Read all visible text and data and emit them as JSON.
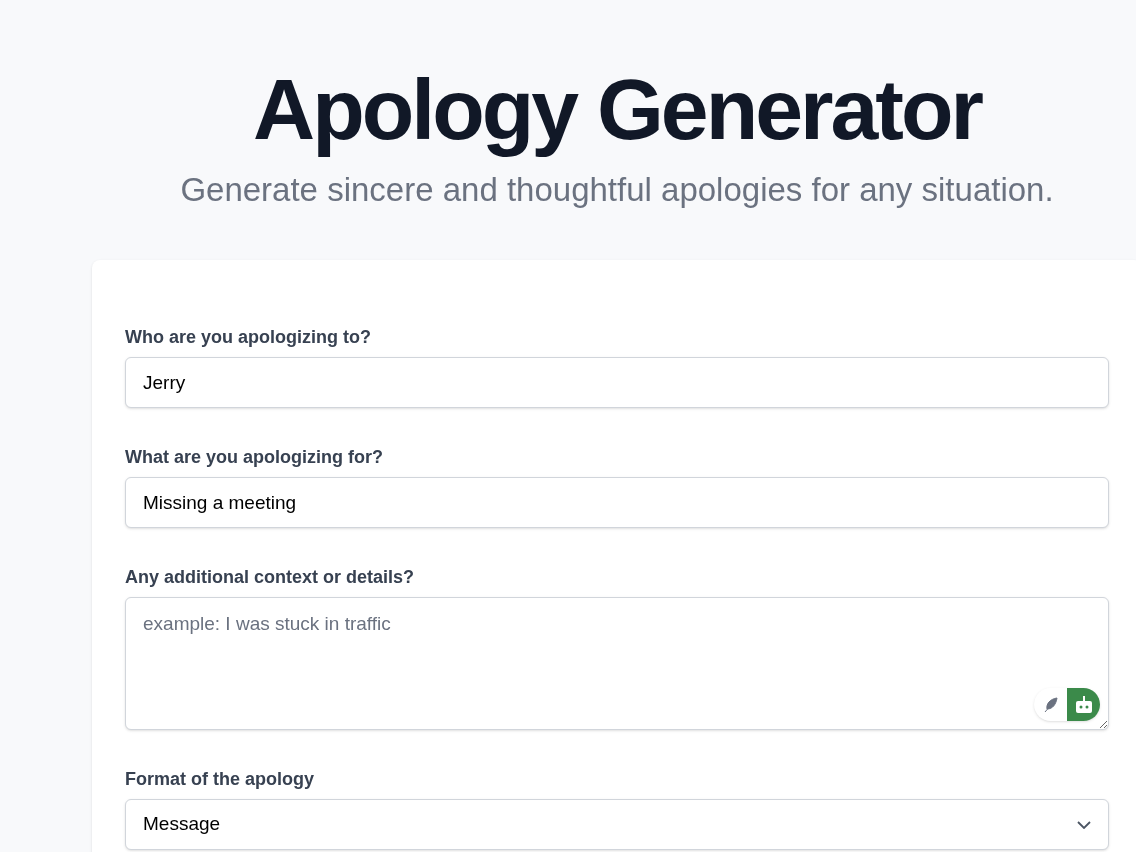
{
  "header": {
    "title": "Apology Generator",
    "subtitle": "Generate sincere and thoughtful apologies for any situation."
  },
  "form": {
    "fields": [
      {
        "kind": "text",
        "label": "Who are you apologizing to?",
        "value": "Jerry"
      },
      {
        "kind": "text",
        "label": "What are you apologizing for?",
        "value": "Missing a meeting"
      },
      {
        "kind": "textarea",
        "label": "Any additional context or details?",
        "placeholder": "example: I was stuck in traffic"
      },
      {
        "kind": "select",
        "label": "Format of the apology",
        "value": "Message"
      }
    ]
  }
}
